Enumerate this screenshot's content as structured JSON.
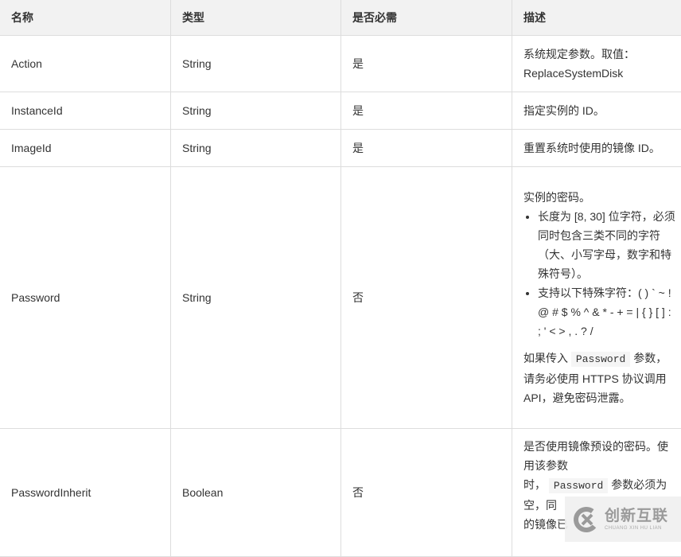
{
  "table": {
    "headers": [
      "名称",
      "类型",
      "是否必需",
      "描述"
    ],
    "rows": [
      {
        "name": "Action",
        "type": "String",
        "required": "是",
        "desc": [
          "系统规定参数。取值：",
          "ReplaceSystemDisk"
        ]
      },
      {
        "name": "InstanceId",
        "type": "String",
        "required": "是",
        "desc": [
          "指定实例的 ID。"
        ]
      },
      {
        "name": "ImageId",
        "type": "String",
        "required": "是",
        "desc": [
          "重置系统时使用的镜像 ID。"
        ]
      },
      {
        "name": "Password",
        "type": "String",
        "required": "否",
        "desc_intro": "实例的密码。",
        "desc_bullets": [
          "长度为 [8, 30] 位字符，必须同时包含三类不同的字符（大、小写字母，数字和特殊符号）。",
          "支持以下特殊字符：( ) ` ~ ! @ # $ % ^ & * - + = | { } [ ] : ; ' < > , . ? /"
        ],
        "desc_note_pre": "如果传入",
        "desc_note_code": "Password",
        "desc_note_post": "参数，请务必使用 HTTPS 协议调用 API，避免密码泄露。"
      },
      {
        "name": "PasswordInherit",
        "type": "Boolean",
        "required": "否",
        "desc_line1": "是否使用镜像预设的密码。使用该参数",
        "desc_pre": "时，",
        "desc_code": "Password",
        "desc_post": "参数必须为空，同",
        "desc_tail": "的镜像已"
      }
    ]
  },
  "watermark": {
    "cn": "创新互联",
    "en": "CHUANG XIN HU LIAN"
  }
}
